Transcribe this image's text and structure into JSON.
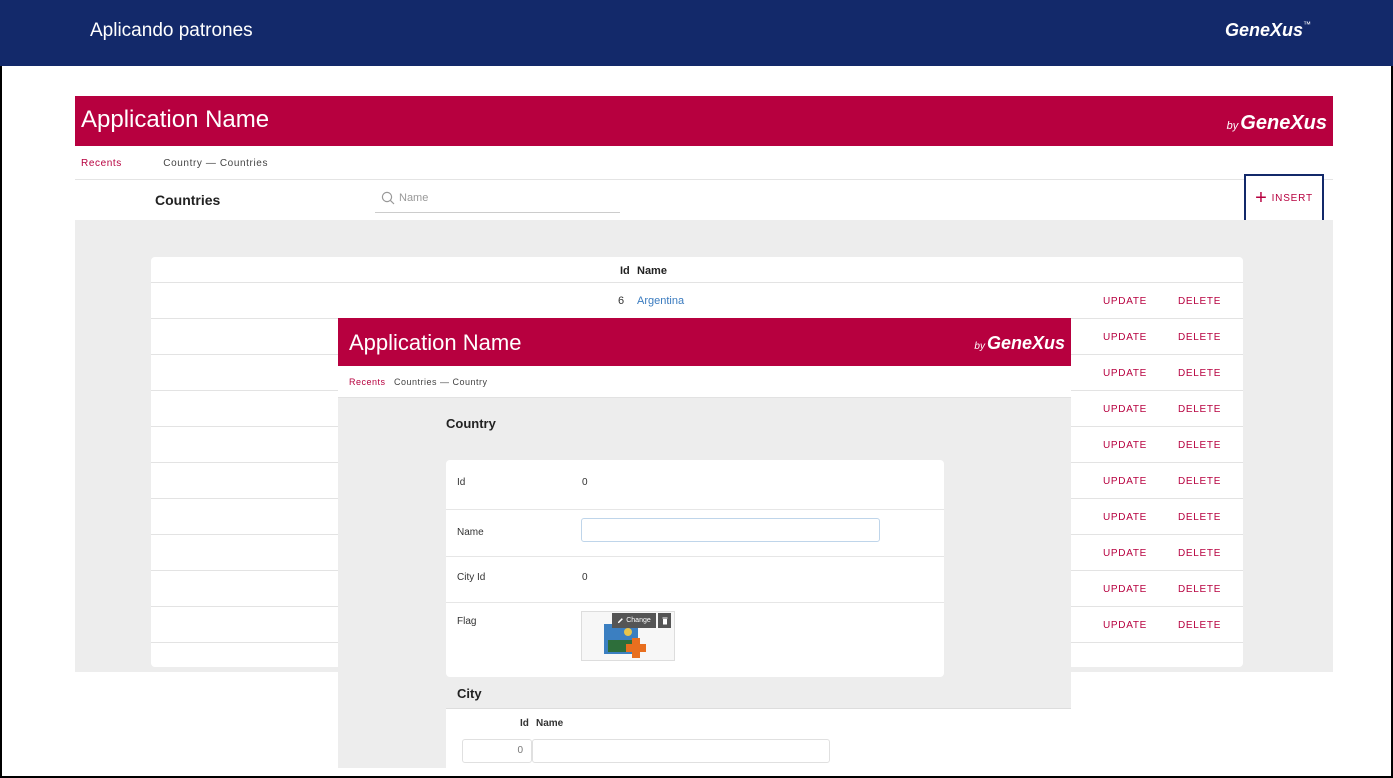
{
  "slide": {
    "title": "Aplicando patrones",
    "logo": "GeneXus",
    "logo_tm": "™"
  },
  "app": {
    "name": "Application Name",
    "by": "by",
    "brand": "GeneXus",
    "breadcrumb": {
      "recents": "Recents",
      "path": "Country — Countries"
    },
    "page_title": "Countries",
    "search": {
      "placeholder": "Name",
      "value": ""
    },
    "insert_label": "INSERT",
    "grid": {
      "columns": [
        "Id",
        "Name"
      ],
      "rows": [
        {
          "id": "6",
          "name": "Argentina",
          "update": "UPDATE",
          "delete": "DELETE"
        },
        {
          "id": "",
          "name": "",
          "update": "UPDATE",
          "delete": "DELETE"
        },
        {
          "id": "",
          "name": "",
          "update": "UPDATE",
          "delete": "DELETE"
        },
        {
          "id": "",
          "name": "",
          "update": "UPDATE",
          "delete": "DELETE"
        },
        {
          "id": "",
          "name": "",
          "update": "UPDATE",
          "delete": "DELETE"
        },
        {
          "id": "",
          "name": "",
          "update": "UPDATE",
          "delete": "DELETE"
        },
        {
          "id": "",
          "name": "",
          "update": "UPDATE",
          "delete": "DELETE"
        },
        {
          "id": "",
          "name": "",
          "update": "UPDATE",
          "delete": "DELETE"
        },
        {
          "id": "",
          "name": "",
          "update": "UPDATE",
          "delete": "DELETE"
        },
        {
          "id": "",
          "name": "",
          "update": "UPDATE",
          "delete": "DELETE"
        }
      ]
    }
  },
  "form": {
    "app_name": "Application Name",
    "by": "by",
    "brand": "GeneXus",
    "breadcrumb": {
      "recents": "Recents",
      "path": "Countries — Country"
    },
    "title": "Country",
    "fields": {
      "id": {
        "label": "Id",
        "value": "0"
      },
      "name": {
        "label": "Name",
        "value": ""
      },
      "city_id": {
        "label": "City Id",
        "value": "0"
      },
      "flag": {
        "label": "Flag",
        "change_label": "Change"
      }
    },
    "city": {
      "title": "City",
      "columns": [
        "Id",
        "Name"
      ],
      "rows": [
        {
          "id": "0",
          "name": ""
        }
      ]
    }
  },
  "colors": {
    "navy": "#13296a",
    "crimson": "#b7003f",
    "link": "#3a7bbf"
  },
  "icons": [
    "search-icon",
    "plus-icon",
    "pencil-icon",
    "trash-icon",
    "flag-placeholder-icon"
  ]
}
